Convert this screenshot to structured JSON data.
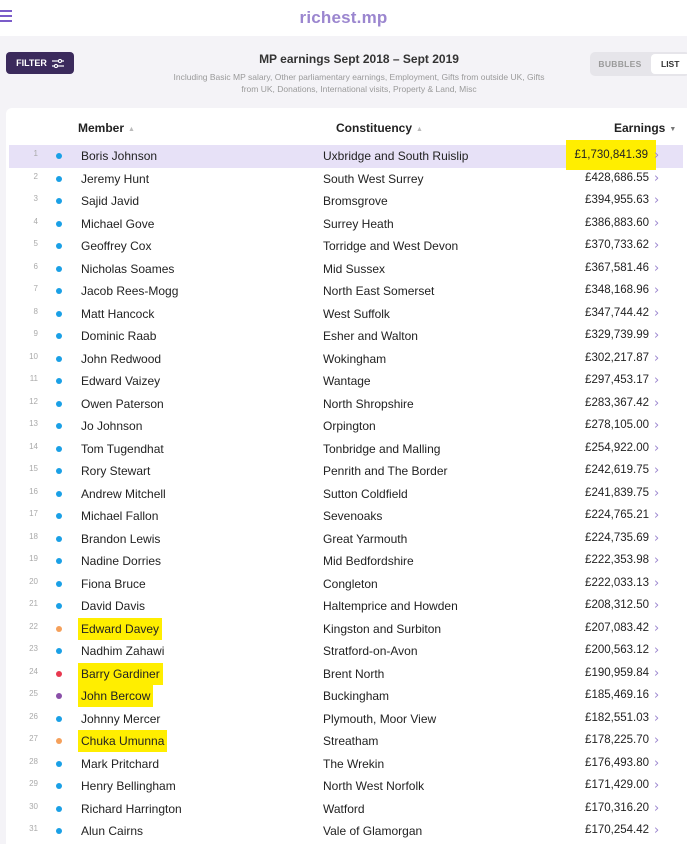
{
  "header": {
    "logo": "richest.mp",
    "filter_label": "FILTER",
    "title": "MP earnings Sept 2018 – Sept 2019",
    "subtitle_line1": "Including Basic MP salary, Other parliamentary earnings, Employment, Gifts from outside UK, Gifts",
    "subtitle_line2": "from UK, Donations, International visits, Property & Land, Misc",
    "toggle_bubbles": "BUBBLES",
    "toggle_list": "LIST"
  },
  "columns": {
    "member": "Member",
    "constituency": "Constituency",
    "earnings": "Earnings"
  },
  "colors": {
    "accent": "#7b5cc9",
    "highlight": "#ffee00",
    "conservative": "#1aa0e6",
    "libdem": "#f5a05a",
    "labour": "#e8384f",
    "speaker": "#8a4fa8"
  },
  "icons": {
    "menu": "hamburger-icon",
    "filter": "sliders-icon",
    "row": "chevron-right-icon"
  },
  "rows": [
    {
      "rank": "1",
      "name": "Boris Johnson",
      "constituency": "Uxbridge and South Ruislip",
      "earnings": "£1,730,841.39",
      "party": "conservative",
      "highlight": true
    },
    {
      "rank": "2",
      "name": "Jeremy Hunt",
      "constituency": "South West Surrey",
      "earnings": "£428,686.55",
      "party": "conservative",
      "highlight": false
    },
    {
      "rank": "3",
      "name": "Sajid Javid",
      "constituency": "Bromsgrove",
      "earnings": "£394,955.63",
      "party": "conservative",
      "highlight": false
    },
    {
      "rank": "4",
      "name": "Michael Gove",
      "constituency": "Surrey Heath",
      "earnings": "£386,883.60",
      "party": "conservative",
      "highlight": false
    },
    {
      "rank": "5",
      "name": "Geoffrey Cox",
      "constituency": "Torridge and West Devon",
      "earnings": "£370,733.62",
      "party": "conservative",
      "highlight": false
    },
    {
      "rank": "6",
      "name": "Nicholas Soames",
      "constituency": "Mid Sussex",
      "earnings": "£367,581.46",
      "party": "conservative",
      "highlight": false
    },
    {
      "rank": "7",
      "name": "Jacob Rees-Mogg",
      "constituency": "North East Somerset",
      "earnings": "£348,168.96",
      "party": "conservative",
      "highlight": false
    },
    {
      "rank": "8",
      "name": "Matt Hancock",
      "constituency": "West Suffolk",
      "earnings": "£347,744.42",
      "party": "conservative",
      "highlight": false
    },
    {
      "rank": "9",
      "name": "Dominic Raab",
      "constituency": "Esher and Walton",
      "earnings": "£329,739.99",
      "party": "conservative",
      "highlight": false
    },
    {
      "rank": "10",
      "name": "John Redwood",
      "constituency": "Wokingham",
      "earnings": "£302,217.87",
      "party": "conservative",
      "highlight": false
    },
    {
      "rank": "11",
      "name": "Edward Vaizey",
      "constituency": "Wantage",
      "earnings": "£297,453.17",
      "party": "conservative",
      "highlight": false
    },
    {
      "rank": "12",
      "name": "Owen Paterson",
      "constituency": "North Shropshire",
      "earnings": "£283,367.42",
      "party": "conservative",
      "highlight": false
    },
    {
      "rank": "13",
      "name": "Jo Johnson",
      "constituency": "Orpington",
      "earnings": "£278,105.00",
      "party": "conservative",
      "highlight": false
    },
    {
      "rank": "14",
      "name": "Tom Tugendhat",
      "constituency": "Tonbridge and Malling",
      "earnings": "£254,922.00",
      "party": "conservative",
      "highlight": false
    },
    {
      "rank": "15",
      "name": "Rory Stewart",
      "constituency": "Penrith and The Border",
      "earnings": "£242,619.75",
      "party": "conservative",
      "highlight": false
    },
    {
      "rank": "16",
      "name": "Andrew Mitchell",
      "constituency": "Sutton Coldfield",
      "earnings": "£241,839.75",
      "party": "conservative",
      "highlight": false
    },
    {
      "rank": "17",
      "name": "Michael Fallon",
      "constituency": "Sevenoaks",
      "earnings": "£224,765.21",
      "party": "conservative",
      "highlight": false
    },
    {
      "rank": "18",
      "name": "Brandon Lewis",
      "constituency": "Great Yarmouth",
      "earnings": "£224,735.69",
      "party": "conservative",
      "highlight": false
    },
    {
      "rank": "19",
      "name": "Nadine Dorries",
      "constituency": "Mid Bedfordshire",
      "earnings": "£222,353.98",
      "party": "conservative",
      "highlight": false
    },
    {
      "rank": "20",
      "name": "Fiona Bruce",
      "constituency": "Congleton",
      "earnings": "£222,033.13",
      "party": "conservative",
      "highlight": false
    },
    {
      "rank": "21",
      "name": "David Davis",
      "constituency": "Haltemprice and Howden",
      "earnings": "£208,312.50",
      "party": "conservative",
      "highlight": false
    },
    {
      "rank": "22",
      "name": "Edward Davey",
      "constituency": "Kingston and Surbiton",
      "earnings": "£207,083.42",
      "party": "libdem",
      "highlight": true
    },
    {
      "rank": "23",
      "name": "Nadhim Zahawi",
      "constituency": "Stratford-on-Avon",
      "earnings": "£200,563.12",
      "party": "conservative",
      "highlight": false
    },
    {
      "rank": "24",
      "name": "Barry Gardiner",
      "constituency": "Brent North",
      "earnings": "£190,959.84",
      "party": "labour",
      "highlight": true
    },
    {
      "rank": "25",
      "name": "John Bercow",
      "constituency": "Buckingham",
      "earnings": "£185,469.16",
      "party": "speaker",
      "highlight": true
    },
    {
      "rank": "26",
      "name": "Johnny Mercer",
      "constituency": "Plymouth, Moor View",
      "earnings": "£182,551.03",
      "party": "conservative",
      "highlight": false
    },
    {
      "rank": "27",
      "name": "Chuka Umunna",
      "constituency": "Streatham",
      "earnings": "£178,225.70",
      "party": "libdem",
      "highlight": true
    },
    {
      "rank": "28",
      "name": "Mark Pritchard",
      "constituency": "The Wrekin",
      "earnings": "£176,493.80",
      "party": "conservative",
      "highlight": false
    },
    {
      "rank": "29",
      "name": "Henry Bellingham",
      "constituency": "North West Norfolk",
      "earnings": "£171,429.00",
      "party": "conservative",
      "highlight": false
    },
    {
      "rank": "30",
      "name": "Richard Harrington",
      "constituency": "Watford",
      "earnings": "£170,316.20",
      "party": "conservative",
      "highlight": false
    },
    {
      "rank": "31",
      "name": "Alun Cairns",
      "constituency": "Vale of Glamorgan",
      "earnings": "£170,254.42",
      "party": "conservative",
      "highlight": false
    }
  ]
}
